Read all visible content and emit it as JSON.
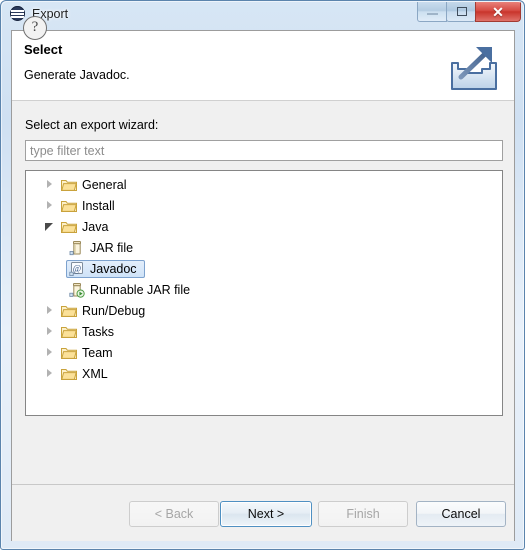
{
  "window": {
    "title": "Export",
    "app_icon": "eclipse-icon",
    "controls": {
      "minimize_label": "minimize-icon",
      "maximize_label": "restore-icon",
      "close_label": "✕"
    },
    "accent_close_color": "#d64b43",
    "titlebar_color": "#cfe0f2"
  },
  "header": {
    "title": "Select",
    "description": "Generate Javadoc.",
    "icon": "export-wizard-icon"
  },
  "body": {
    "wizard_label": "Select an export wizard:",
    "filter": {
      "value": "",
      "placeholder": "type filter text"
    },
    "tree": [
      {
        "label": "General",
        "level": 0,
        "state": "collapsed",
        "icon": "folder-icon",
        "selected": false
      },
      {
        "label": "Install",
        "level": 0,
        "state": "collapsed",
        "icon": "folder-icon",
        "selected": false
      },
      {
        "label": "Java",
        "level": 0,
        "state": "expanded",
        "icon": "folder-icon",
        "selected": false
      },
      {
        "label": "JAR file",
        "level": 1,
        "state": "leaf",
        "icon": "jar-file-icon",
        "selected": false
      },
      {
        "label": "Javadoc",
        "level": 1,
        "state": "leaf",
        "icon": "javadoc-at-icon",
        "selected": true
      },
      {
        "label": "Runnable JAR file",
        "level": 1,
        "state": "leaf",
        "icon": "runnable-jar-icon",
        "selected": false
      },
      {
        "label": "Run/Debug",
        "level": 0,
        "state": "collapsed",
        "icon": "folder-icon",
        "selected": false
      },
      {
        "label": "Tasks",
        "level": 0,
        "state": "collapsed",
        "icon": "folder-icon",
        "selected": false
      },
      {
        "label": "Team",
        "level": 0,
        "state": "collapsed",
        "icon": "folder-icon",
        "selected": false
      },
      {
        "label": "XML",
        "level": 0,
        "state": "collapsed",
        "icon": "folder-icon",
        "selected": false
      }
    ],
    "selection_color": "#cfe3f8"
  },
  "footer": {
    "help_label": "?",
    "back_label": "< Back",
    "next_label": "Next >",
    "finish_label": "Finish",
    "cancel_label": "Cancel",
    "back_enabled": false,
    "next_enabled": true,
    "next_is_default": true,
    "finish_enabled": false,
    "cancel_enabled": true
  }
}
